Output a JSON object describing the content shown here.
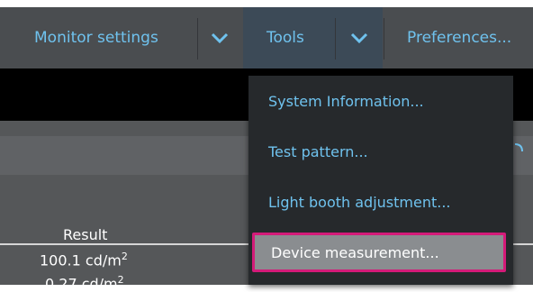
{
  "menubar": {
    "monitor_settings": "Monitor settings",
    "tools": "Tools",
    "preferences": "Preferences..."
  },
  "tools_menu": {
    "items": [
      {
        "label": "System Information..."
      },
      {
        "label": "Test pattern..."
      },
      {
        "label": "Light booth adjustment..."
      },
      {
        "label": "Device measurement..."
      }
    ]
  },
  "table": {
    "result_header": "Result",
    "rows": [
      {
        "value": "100.1 cd/m",
        "superscript": "2"
      },
      {
        "value": "0.27 cd/m",
        "superscript": "2"
      }
    ]
  },
  "colors": {
    "accent": "#6fc2ee",
    "highlight_border": "#d41b79"
  }
}
